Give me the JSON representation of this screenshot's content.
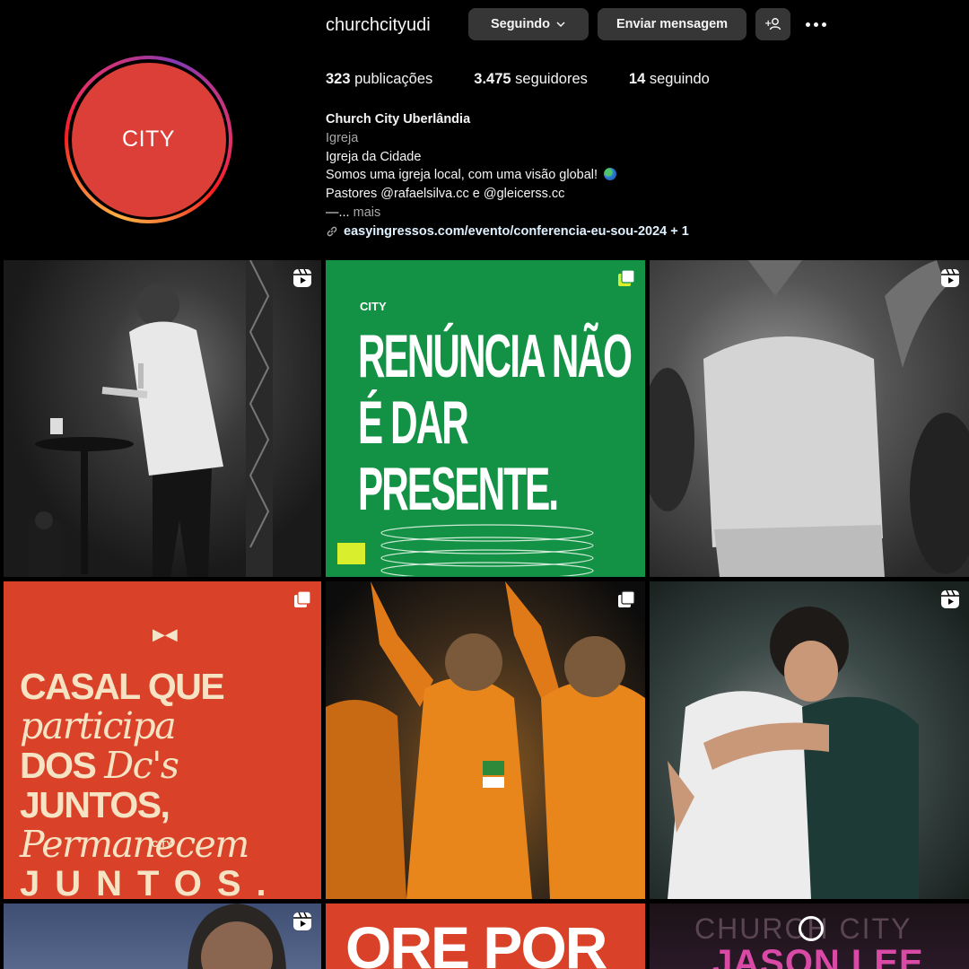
{
  "profile": {
    "username": "churchcityudi",
    "avatar_text": "CITY",
    "buttons": {
      "following": "Seguindo",
      "message": "Enviar mensagem"
    },
    "stats": {
      "posts_count": "323",
      "posts_label": "publicações",
      "followers_count": "3.475",
      "followers_label": "seguidores",
      "following_count": "14",
      "following_label": "seguindo"
    },
    "bio": {
      "name": "Church City Uberlândia",
      "category": "Igreja",
      "line1": "Igreja da Cidade",
      "line2": "Somos uma igreja local, com uma visão global!",
      "line3": "Pastores @rafaelsilva.cc e @gleicerss.cc",
      "truncated": "—...",
      "more": "mais",
      "link": "easyingressos.com/evento/conferencia-eu-sou-2024 + 1"
    }
  },
  "posts": {
    "renuncia": {
      "brand": "CITY",
      "line1": "RENÚNCIA NÃO",
      "line2": "É DAR PRESENTE."
    },
    "casal": {
      "line1a": "CASAL QUE",
      "line1b": "participa",
      "line2a": "DOS",
      "line2b": "Dc's",
      "line2c": "JUNTOS,",
      "line3": "Permanecem",
      "line4": "JUNTOS.",
      "brand": "CITY"
    },
    "ore": {
      "headline": "ORE POR"
    },
    "jason": {
      "watermark": "CHURCH CITY",
      "headline": "JASON LEE"
    }
  },
  "colors": {
    "background": "#000000",
    "button": "#363636",
    "green_post": "#139245",
    "red_post": "#d94228",
    "avatar": "#dc3f38"
  }
}
